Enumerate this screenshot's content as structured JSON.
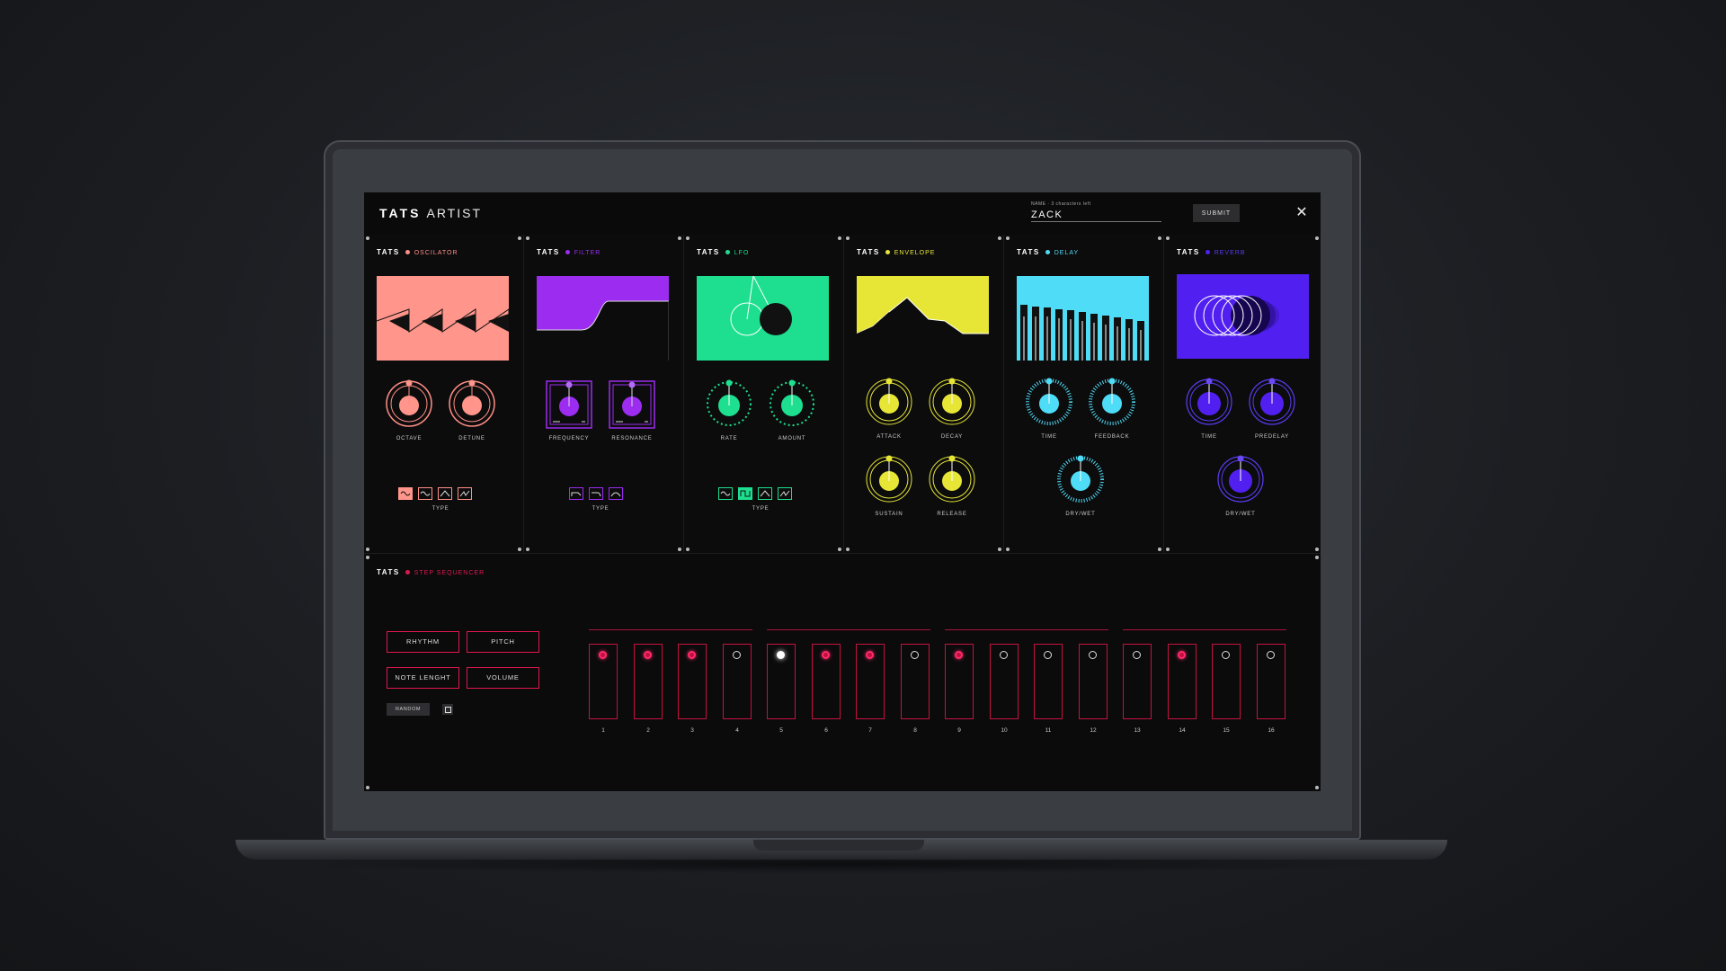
{
  "app": {
    "brand": "TATS",
    "title": "ARTIST"
  },
  "name_field": {
    "label": "NAME · 3 characters left",
    "value": "ZACK"
  },
  "submit_label": "SUBMIT",
  "close_icon": "close-icon",
  "modules": [
    {
      "id": "oscillator",
      "brand": "TATS",
      "title": "OSCILATOR",
      "color": "#ff8f86",
      "knobs": [
        "OCTAVE",
        "DETUNE"
      ],
      "type_label": "TYPE"
    },
    {
      "id": "filter",
      "brand": "TATS",
      "title": "FILTER",
      "color": "#9b2cf0",
      "knobs": [
        "FREQUENCY",
        "RESONANCE"
      ],
      "type_label": "TYPE"
    },
    {
      "id": "lfo",
      "brand": "TATS",
      "title": "LFO",
      "color": "#1ddf8f",
      "knobs": [
        "RATE",
        "AMOUNT"
      ],
      "type_label": "TYPE"
    },
    {
      "id": "envelope",
      "brand": "TATS",
      "title": "ENVELOPE",
      "color": "#e7e637",
      "knobs": [
        "ATTACK",
        "DECAY",
        "SUSTAIN",
        "RELEASE"
      ]
    },
    {
      "id": "delay",
      "brand": "TATS",
      "title": "DELAY",
      "color": "#4fdcf6",
      "knobs": [
        "TIME",
        "FEEDBACK",
        "DRY/WET"
      ]
    },
    {
      "id": "reverb",
      "brand": "TATS",
      "title": "REVERB",
      "color": "#5120f0",
      "knobs": [
        "TIME",
        "PREDELAY",
        "DRY/WET"
      ]
    }
  ],
  "sequencer": {
    "brand": "TATS",
    "title": "STEP SEQUENCER",
    "buttons": [
      "RHYTHM",
      "PITCH",
      "NOTE LENGHT",
      "VOLUME"
    ],
    "random_label": "RANDOM",
    "steps": [
      {
        "n": "1",
        "state": "on"
      },
      {
        "n": "2",
        "state": "on"
      },
      {
        "n": "3",
        "state": "on"
      },
      {
        "n": "4",
        "state": "off"
      },
      {
        "n": "5",
        "state": "current"
      },
      {
        "n": "6",
        "state": "on"
      },
      {
        "n": "7",
        "state": "on"
      },
      {
        "n": "8",
        "state": "off"
      },
      {
        "n": "9",
        "state": "on"
      },
      {
        "n": "10",
        "state": "off"
      },
      {
        "n": "11",
        "state": "off"
      },
      {
        "n": "12",
        "state": "off"
      },
      {
        "n": "13",
        "state": "off"
      },
      {
        "n": "14",
        "state": "on"
      },
      {
        "n": "15",
        "state": "off"
      },
      {
        "n": "16",
        "state": "off"
      }
    ]
  }
}
